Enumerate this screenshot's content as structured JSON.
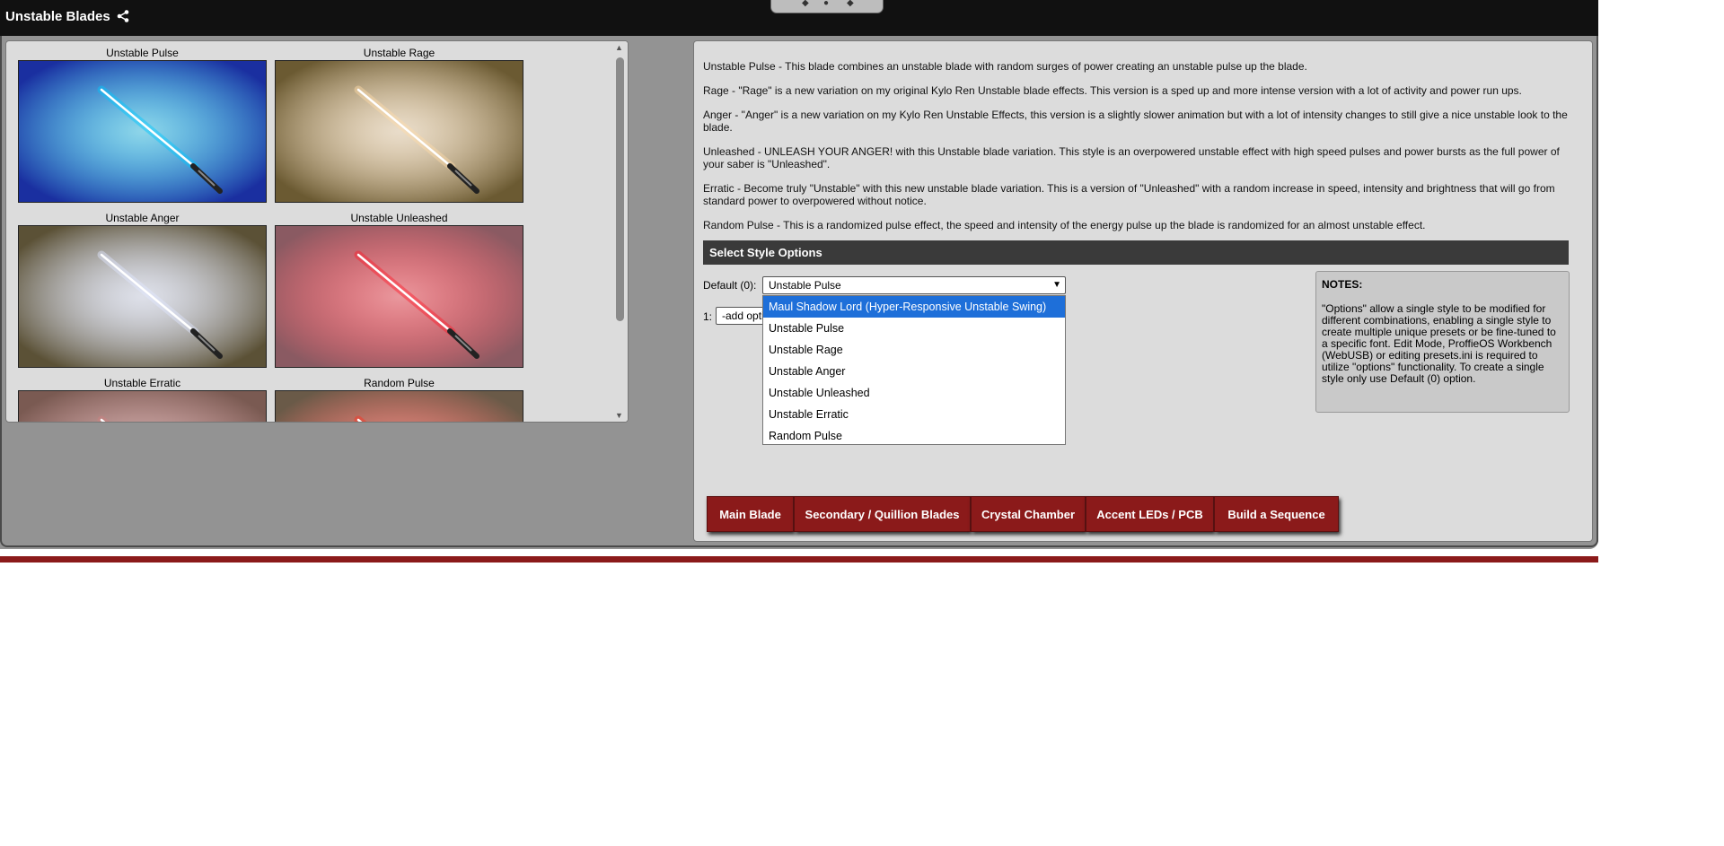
{
  "window": {
    "title": "Unstable Blades",
    "title_icon": "share-icon"
  },
  "gallery": {
    "tiles": [
      {
        "label": "Unstable Pulse",
        "blade_color": "#00c8ff"
      },
      {
        "label": "Unstable Rage",
        "blade_color": "#ffdca8"
      },
      {
        "label": "Unstable Anger",
        "blade_color": "#dfe6ff"
      },
      {
        "label": "Unstable Unleashed",
        "blade_color": "#ff1a2a"
      },
      {
        "label": "Unstable Erratic",
        "blade_color": "#d08080"
      },
      {
        "label": "Random Pulse",
        "blade_color": "#ff3020"
      }
    ]
  },
  "descriptions": [
    "Unstable Pulse - This blade combines an unstable blade with random surges of power creating an unstable pulse up the blade.",
    "Rage - \"Rage\" is a new variation on my original Kylo Ren Unstable blade effects. This version is a sped up and more intense version with a lot of activity and power run ups.",
    "Anger - \"Anger\" is a new variation on my Kylo Ren Unstable Effects, this version is a slightly slower animation but with a lot of intensity changes to still give a nice unstable look to the blade.",
    "Unleashed - UNLEASH YOUR ANGER! with this Unstable blade variation. This style is an overpowered unstable effect with high speed pulses and power bursts as the full power of your saber is \"Unleashed\".",
    "Erratic - Become truly \"Unstable\" with this new unstable blade variation. This is a version of \"Unleashed\" with a random increase in speed, intensity and brightness that will go from standard power to overpowered without notice.",
    "Random Pulse - This is a randomized pulse effect, the speed and intensity of the energy pulse up the blade is randomized for an almost unstable effect."
  ],
  "style_options": {
    "header": "Select Style Options",
    "default_label": "Default (0):",
    "default_value": "Unstable Pulse",
    "row1_label": "1:",
    "row1_value": "-add option-",
    "dropdown_options": [
      "Maul Shadow Lord (Hyper-Responsive Unstable Swing)",
      "Unstable Pulse",
      "Unstable Rage",
      "Unstable Anger",
      "Unstable Unleashed",
      "Unstable Erratic",
      "Random Pulse"
    ],
    "highlighted_option": "Maul Shadow Lord (Hyper-Responsive Unstable Swing)"
  },
  "notes": {
    "heading": "NOTES:",
    "body": "\"Options\" allow a single style to be modified for different combinations, enabling a single style to create multiple unique presets or be fine-tuned to a specific font. Edit Mode, ProffieOS Workbench (WebUSB) or editing presets.ini is required to utilize \"options\" functionality. To create a single style only use Default (0) option."
  },
  "tabs": [
    "Main Blade",
    "Secondary / Quillion Blades",
    "Crystal Chamber",
    "Accent LEDs / PCB",
    "Build a Sequence"
  ],
  "colors": {
    "accent": "#8b1a1a",
    "titlebar": "#111111",
    "highlight": "#1e6fd9"
  }
}
